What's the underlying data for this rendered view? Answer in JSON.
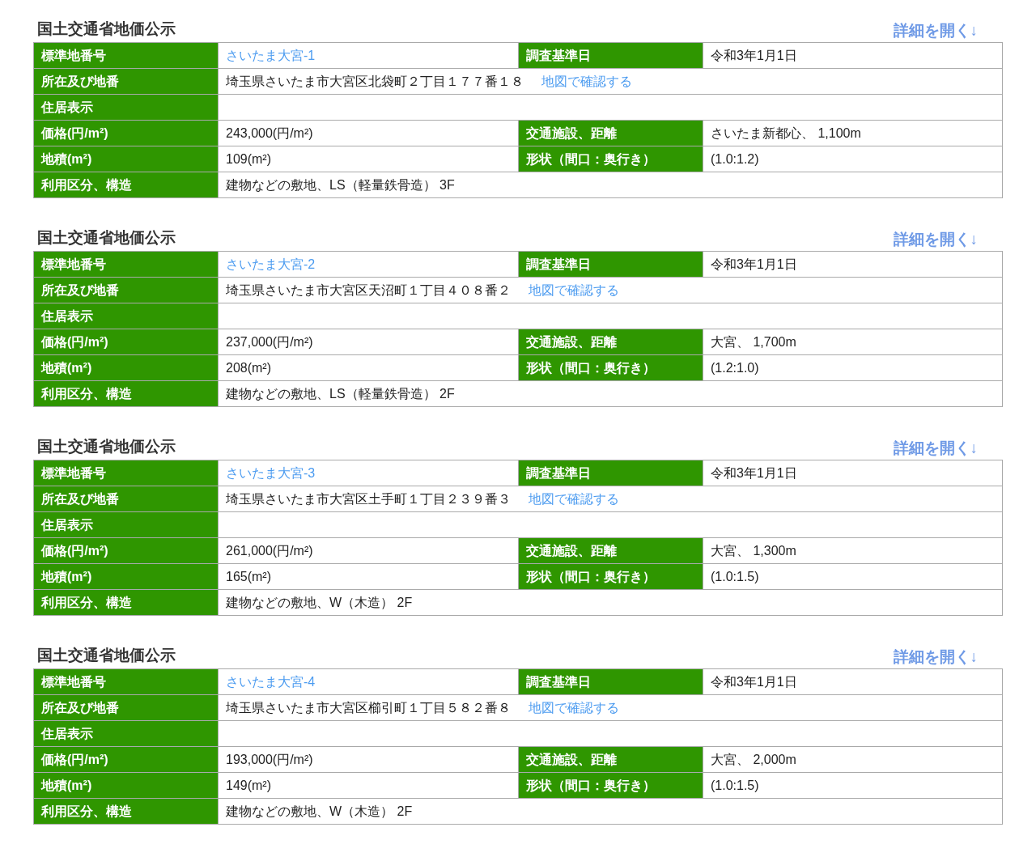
{
  "sections": [
    {
      "title": "国土交通省地価公示",
      "detail_link": "詳細を開く↓",
      "rows": [
        [
          {
            "label": "標準地番号",
            "value": "さいたま大宮-1",
            "kind": "link"
          },
          {
            "label": "調査基準日",
            "value": "令和3年1月1日",
            "kind": "text"
          }
        ],
        [
          {
            "label": "所在及び地番",
            "value": "埼玉県さいたま市大宮区北袋町２丁目１７７番１８",
            "kind": "text",
            "map_link": "地図で確認する"
          }
        ],
        [
          {
            "label": "住居表示"
          }
        ],
        [
          {
            "label": "価格(円/m²)",
            "value": "243,000(円/m²)",
            "kind": "text"
          },
          {
            "label": "交通施設、距離",
            "value": "さいたま新都心、 1,100m",
            "kind": "text"
          }
        ],
        [
          {
            "label": "地積(m²)",
            "value": "109(m²)",
            "kind": "text"
          },
          {
            "label": "形状（間口：奥行き）",
            "value": "(1.0:1.2)",
            "kind": "text"
          }
        ],
        [
          {
            "label": "利用区分、構造",
            "value": "建物などの敷地、LS（軽量鉄骨造） 3F",
            "kind": "text"
          }
        ]
      ]
    },
    {
      "title": "国土交通省地価公示",
      "detail_link": "詳細を開く↓",
      "rows": [
        [
          {
            "label": "標準地番号",
            "value": "さいたま大宮-2",
            "kind": "link"
          },
          {
            "label": "調査基準日",
            "value": "令和3年1月1日",
            "kind": "text"
          }
        ],
        [
          {
            "label": "所在及び地番",
            "value": "埼玉県さいたま市大宮区天沼町１丁目４０８番２",
            "kind": "text",
            "map_link": "地図で確認する"
          }
        ],
        [
          {
            "label": "住居表示"
          }
        ],
        [
          {
            "label": "価格(円/m²)",
            "value": "237,000(円/m²)",
            "kind": "text"
          },
          {
            "label": "交通施設、距離",
            "value": "大宮、 1,700m",
            "kind": "text"
          }
        ],
        [
          {
            "label": "地積(m²)",
            "value": "208(m²)",
            "kind": "text"
          },
          {
            "label": "形状（間口：奥行き）",
            "value": "(1.2:1.0)",
            "kind": "text"
          }
        ],
        [
          {
            "label": "利用区分、構造",
            "value": "建物などの敷地、LS（軽量鉄骨造） 2F",
            "kind": "text"
          }
        ]
      ]
    },
    {
      "title": "国土交通省地価公示",
      "detail_link": "詳細を開く↓",
      "rows": [
        [
          {
            "label": "標準地番号",
            "value": "さいたま大宮-3",
            "kind": "link"
          },
          {
            "label": "調査基準日",
            "value": "令和3年1月1日",
            "kind": "text"
          }
        ],
        [
          {
            "label": "所在及び地番",
            "value": "埼玉県さいたま市大宮区土手町１丁目２３９番３",
            "kind": "text",
            "map_link": "地図で確認する"
          }
        ],
        [
          {
            "label": "住居表示"
          }
        ],
        [
          {
            "label": "価格(円/m²)",
            "value": "261,000(円/m²)",
            "kind": "text"
          },
          {
            "label": "交通施設、距離",
            "value": "大宮、 1,300m",
            "kind": "text"
          }
        ],
        [
          {
            "label": "地積(m²)",
            "value": "165(m²)",
            "kind": "text"
          },
          {
            "label": "形状（間口：奥行き）",
            "value": "(1.0:1.5)",
            "kind": "text"
          }
        ],
        [
          {
            "label": "利用区分、構造",
            "value": "建物などの敷地、W（木造） 2F",
            "kind": "text"
          }
        ]
      ]
    },
    {
      "title": "国土交通省地価公示",
      "detail_link": "詳細を開く↓",
      "rows": [
        [
          {
            "label": "標準地番号",
            "value": "さいたま大宮-4",
            "kind": "link"
          },
          {
            "label": "調査基準日",
            "value": "令和3年1月1日",
            "kind": "text"
          }
        ],
        [
          {
            "label": "所在及び地番",
            "value": "埼玉県さいたま市大宮区櫛引町１丁目５８２番８",
            "kind": "text",
            "map_link": "地図で確認する"
          }
        ],
        [
          {
            "label": "住居表示"
          }
        ],
        [
          {
            "label": "価格(円/m²)",
            "value": "193,000(円/m²)",
            "kind": "text"
          },
          {
            "label": "交通施設、距離",
            "value": "大宮、 2,000m",
            "kind": "text"
          }
        ],
        [
          {
            "label": "地積(m²)",
            "value": "149(m²)",
            "kind": "text"
          },
          {
            "label": "形状（間口：奥行き）",
            "value": "(1.0:1.5)",
            "kind": "text"
          }
        ],
        [
          {
            "label": "利用区分、構造",
            "value": "建物などの敷地、W（木造） 2F",
            "kind": "text"
          }
        ]
      ]
    }
  ]
}
